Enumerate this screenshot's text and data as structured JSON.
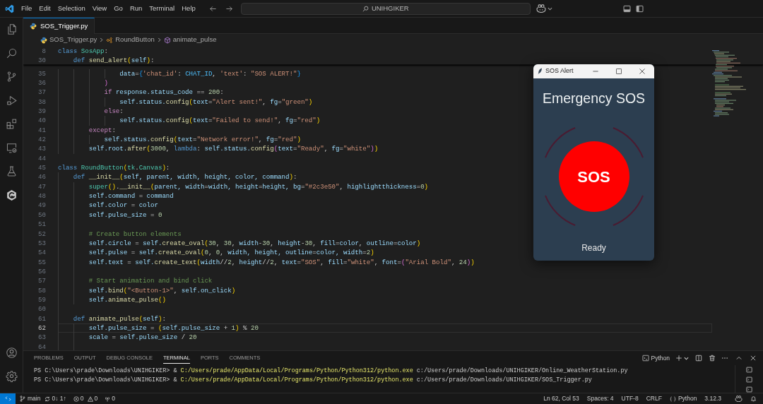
{
  "title_bar": {
    "menu": [
      "File",
      "Edit",
      "Selection",
      "View",
      "Go",
      "Run",
      "Terminal",
      "Help"
    ],
    "search": {
      "value": "UNIHGIKER"
    }
  },
  "tabs": [
    {
      "label": "SOS_Trigger.py",
      "selected": true
    }
  ],
  "breadcrumbs": [
    {
      "kind": "file",
      "label": "SOS_Trigger.py"
    },
    {
      "kind": "class",
      "label": "RoundButton"
    },
    {
      "kind": "method",
      "label": "animate_pulse"
    }
  ],
  "editor": {
    "sticky_lines": [
      {
        "number": "8",
        "tokens": [
          {
            "kind": "kw",
            "text": "class "
          },
          {
            "kind": "cls",
            "text": "SosApp"
          },
          {
            "kind": "plain",
            "text": ":"
          }
        ]
      },
      {
        "number": "30",
        "tokens": [
          {
            "kind": "kw",
            "text": "    def "
          },
          {
            "kind": "fn",
            "text": "send_alert"
          },
          {
            "kind": "br1",
            "text": "("
          },
          {
            "kind": "var",
            "text": "self"
          },
          {
            "kind": "br1",
            "text": ")"
          },
          {
            "kind": "plain",
            "text": ":"
          }
        ]
      }
    ],
    "lines": [
      {
        "number": "35",
        "current": false,
        "tokens": [
          {
            "kind": "var",
            "text": "                data"
          },
          {
            "kind": "plain",
            "text": "="
          },
          {
            "kind": "br3",
            "text": "{"
          },
          {
            "kind": "str",
            "text": "'chat_id'"
          },
          {
            "kind": "plain",
            "text": ": "
          },
          {
            "kind": "const",
            "text": "CHAT_ID"
          },
          {
            "kind": "plain",
            "text": ", "
          },
          {
            "kind": "str",
            "text": "'text'"
          },
          {
            "kind": "plain",
            "text": ": "
          },
          {
            "kind": "str",
            "text": "\"SOS ALERT!\""
          },
          {
            "kind": "br3",
            "text": "}"
          }
        ]
      },
      {
        "number": "36",
        "current": false,
        "tokens": [
          {
            "kind": "br2",
            "text": "            )"
          }
        ]
      },
      {
        "number": "37",
        "current": false,
        "tokens": [
          {
            "kind": "ctl",
            "text": "            if "
          },
          {
            "kind": "var",
            "text": "response.status_code"
          },
          {
            "kind": "plain",
            "text": " == "
          },
          {
            "kind": "num",
            "text": "200"
          },
          {
            "kind": "plain",
            "text": ":"
          }
        ]
      },
      {
        "number": "38",
        "current": false,
        "tokens": [
          {
            "kind": "var",
            "text": "                self.status."
          },
          {
            "kind": "fn",
            "text": "config"
          },
          {
            "kind": "br1",
            "text": "("
          },
          {
            "kind": "var",
            "text": "text"
          },
          {
            "kind": "plain",
            "text": "="
          },
          {
            "kind": "str",
            "text": "\"Alert sent!\""
          },
          {
            "kind": "plain",
            "text": ", "
          },
          {
            "kind": "var",
            "text": "fg"
          },
          {
            "kind": "plain",
            "text": "="
          },
          {
            "kind": "str",
            "text": "\"green\""
          },
          {
            "kind": "br1",
            "text": ")"
          }
        ]
      },
      {
        "number": "39",
        "current": false,
        "tokens": [
          {
            "kind": "ctl",
            "text": "            else"
          },
          {
            "kind": "plain",
            "text": ":"
          }
        ]
      },
      {
        "number": "40",
        "current": false,
        "tokens": [
          {
            "kind": "var",
            "text": "                self.status."
          },
          {
            "kind": "fn",
            "text": "config"
          },
          {
            "kind": "br1",
            "text": "("
          },
          {
            "kind": "var",
            "text": "text"
          },
          {
            "kind": "plain",
            "text": "="
          },
          {
            "kind": "str",
            "text": "\"Failed to send!\""
          },
          {
            "kind": "plain",
            "text": ", "
          },
          {
            "kind": "var",
            "text": "fg"
          },
          {
            "kind": "plain",
            "text": "="
          },
          {
            "kind": "str",
            "text": "\"red\""
          },
          {
            "kind": "br1",
            "text": ")"
          }
        ]
      },
      {
        "number": "41",
        "current": false,
        "tokens": [
          {
            "kind": "ctl",
            "text": "        except"
          },
          {
            "kind": "plain",
            "text": ":"
          }
        ]
      },
      {
        "number": "42",
        "current": false,
        "tokens": [
          {
            "kind": "var",
            "text": "            self.status."
          },
          {
            "kind": "fn",
            "text": "config"
          },
          {
            "kind": "br1",
            "text": "("
          },
          {
            "kind": "var",
            "text": "text"
          },
          {
            "kind": "plain",
            "text": "="
          },
          {
            "kind": "str",
            "text": "\"Network error!\""
          },
          {
            "kind": "plain",
            "text": ", "
          },
          {
            "kind": "var",
            "text": "fg"
          },
          {
            "kind": "plain",
            "text": "="
          },
          {
            "kind": "str",
            "text": "\"red\""
          },
          {
            "kind": "br1",
            "text": ")"
          }
        ]
      },
      {
        "number": "43",
        "current": false,
        "tokens": [
          {
            "kind": "var",
            "text": "        self.root."
          },
          {
            "kind": "fn",
            "text": "after"
          },
          {
            "kind": "br1",
            "text": "("
          },
          {
            "kind": "num",
            "text": "3000"
          },
          {
            "kind": "plain",
            "text": ", "
          },
          {
            "kind": "kw",
            "text": "lambda"
          },
          {
            "kind": "plain",
            "text": ": "
          },
          {
            "kind": "var",
            "text": "self.status."
          },
          {
            "kind": "fn",
            "text": "config"
          },
          {
            "kind": "br2",
            "text": "("
          },
          {
            "kind": "var",
            "text": "text"
          },
          {
            "kind": "plain",
            "text": "="
          },
          {
            "kind": "str",
            "text": "\"Ready\""
          },
          {
            "kind": "plain",
            "text": ", "
          },
          {
            "kind": "var",
            "text": "fg"
          },
          {
            "kind": "plain",
            "text": "="
          },
          {
            "kind": "str",
            "text": "\"white\""
          },
          {
            "kind": "br2",
            "text": ")"
          },
          {
            "kind": "br1",
            "text": ")"
          }
        ]
      },
      {
        "number": "44",
        "current": false
      },
      {
        "number": "45",
        "current": false,
        "tokens": [
          {
            "kind": "kw",
            "text": "class "
          },
          {
            "kind": "cls",
            "text": "RoundButton"
          },
          {
            "kind": "br1",
            "text": "("
          },
          {
            "kind": "cls",
            "text": "tk"
          },
          {
            "kind": "plain",
            "text": "."
          },
          {
            "kind": "cls",
            "text": "Canvas"
          },
          {
            "kind": "br1",
            "text": ")"
          },
          {
            "kind": "plain",
            "text": ":"
          }
        ]
      },
      {
        "number": "46",
        "current": false,
        "tokens": [
          {
            "kind": "kw",
            "text": "    def "
          },
          {
            "kind": "fn",
            "text": "__init__"
          },
          {
            "kind": "br1",
            "text": "("
          },
          {
            "kind": "var",
            "text": "self, parent, width, height, color, command"
          },
          {
            "kind": "br1",
            "text": ")"
          },
          {
            "kind": "plain",
            "text": ":"
          }
        ]
      },
      {
        "number": "47",
        "current": false,
        "tokens": [
          {
            "kind": "cls",
            "text": "        super"
          },
          {
            "kind": "br1",
            "text": "()"
          },
          {
            "kind": "plain",
            "text": "."
          },
          {
            "kind": "fn",
            "text": "__init__"
          },
          {
            "kind": "br1",
            "text": "("
          },
          {
            "kind": "var",
            "text": "parent, width"
          },
          {
            "kind": "plain",
            "text": "="
          },
          {
            "kind": "var",
            "text": "width, height"
          },
          {
            "kind": "plain",
            "text": "="
          },
          {
            "kind": "var",
            "text": "height, bg"
          },
          {
            "kind": "plain",
            "text": "="
          },
          {
            "kind": "str",
            "text": "\"#2c3e50\""
          },
          {
            "kind": "plain",
            "text": ", "
          },
          {
            "kind": "var",
            "text": "highlightthickness"
          },
          {
            "kind": "plain",
            "text": "="
          },
          {
            "kind": "num",
            "text": "0"
          },
          {
            "kind": "br1",
            "text": ")"
          }
        ]
      },
      {
        "number": "48",
        "current": false,
        "tokens": [
          {
            "kind": "var",
            "text": "        self.command"
          },
          {
            "kind": "plain",
            "text": " = "
          },
          {
            "kind": "var",
            "text": "command"
          }
        ]
      },
      {
        "number": "49",
        "current": false,
        "tokens": [
          {
            "kind": "var",
            "text": "        self.color"
          },
          {
            "kind": "plain",
            "text": " = "
          },
          {
            "kind": "var",
            "text": "color"
          }
        ]
      },
      {
        "number": "50",
        "current": false,
        "tokens": [
          {
            "kind": "var",
            "text": "        self.pulse_size"
          },
          {
            "kind": "plain",
            "text": " = "
          },
          {
            "kind": "num",
            "text": "0"
          }
        ]
      },
      {
        "number": "51",
        "current": false
      },
      {
        "number": "52",
        "current": false,
        "tokens": [
          {
            "kind": "cmt",
            "text": "        # Create button elements"
          }
        ]
      },
      {
        "number": "53",
        "current": false,
        "tokens": [
          {
            "kind": "var",
            "text": "        self.circle"
          },
          {
            "kind": "plain",
            "text": " = "
          },
          {
            "kind": "var",
            "text": "self."
          },
          {
            "kind": "fn",
            "text": "create_oval"
          },
          {
            "kind": "br1",
            "text": "("
          },
          {
            "kind": "num",
            "text": "30"
          },
          {
            "kind": "plain",
            "text": ", "
          },
          {
            "kind": "num",
            "text": "30"
          },
          {
            "kind": "plain",
            "text": ", "
          },
          {
            "kind": "var",
            "text": "width"
          },
          {
            "kind": "plain",
            "text": "-"
          },
          {
            "kind": "num",
            "text": "30"
          },
          {
            "kind": "plain",
            "text": ", "
          },
          {
            "kind": "var",
            "text": "height"
          },
          {
            "kind": "plain",
            "text": "-"
          },
          {
            "kind": "num",
            "text": "30"
          },
          {
            "kind": "plain",
            "text": ", "
          },
          {
            "kind": "var",
            "text": "fill"
          },
          {
            "kind": "plain",
            "text": "="
          },
          {
            "kind": "var",
            "text": "color"
          },
          {
            "kind": "plain",
            "text": ", "
          },
          {
            "kind": "var",
            "text": "outline"
          },
          {
            "kind": "plain",
            "text": "="
          },
          {
            "kind": "var",
            "text": "color"
          },
          {
            "kind": "br1",
            "text": ")"
          }
        ]
      },
      {
        "number": "54",
        "current": false,
        "tokens": [
          {
            "kind": "var",
            "text": "        self.pulse"
          },
          {
            "kind": "plain",
            "text": " = "
          },
          {
            "kind": "var",
            "text": "self."
          },
          {
            "kind": "fn",
            "text": "create_oval"
          },
          {
            "kind": "br1",
            "text": "("
          },
          {
            "kind": "num",
            "text": "0"
          },
          {
            "kind": "plain",
            "text": ", "
          },
          {
            "kind": "num",
            "text": "0"
          },
          {
            "kind": "plain",
            "text": ", "
          },
          {
            "kind": "var",
            "text": "width, height, outline"
          },
          {
            "kind": "plain",
            "text": "="
          },
          {
            "kind": "var",
            "text": "color, width"
          },
          {
            "kind": "plain",
            "text": "="
          },
          {
            "kind": "num",
            "text": "2"
          },
          {
            "kind": "br1",
            "text": ")"
          }
        ]
      },
      {
        "number": "55",
        "current": false,
        "tokens": [
          {
            "kind": "var",
            "text": "        self.text"
          },
          {
            "kind": "plain",
            "text": " = "
          },
          {
            "kind": "var",
            "text": "self."
          },
          {
            "kind": "fn",
            "text": "create_text"
          },
          {
            "kind": "br1",
            "text": "("
          },
          {
            "kind": "var",
            "text": "width"
          },
          {
            "kind": "plain",
            "text": "//"
          },
          {
            "kind": "num",
            "text": "2"
          },
          {
            "kind": "plain",
            "text": ", "
          },
          {
            "kind": "var",
            "text": "height"
          },
          {
            "kind": "plain",
            "text": "//"
          },
          {
            "kind": "num",
            "text": "2"
          },
          {
            "kind": "plain",
            "text": ", "
          },
          {
            "kind": "var",
            "text": "text"
          },
          {
            "kind": "plain",
            "text": "="
          },
          {
            "kind": "str",
            "text": "\"SOS\""
          },
          {
            "kind": "plain",
            "text": ", "
          },
          {
            "kind": "var",
            "text": "fill"
          },
          {
            "kind": "plain",
            "text": "="
          },
          {
            "kind": "str",
            "text": "\"white\""
          },
          {
            "kind": "plain",
            "text": ", "
          },
          {
            "kind": "var",
            "text": "font"
          },
          {
            "kind": "plain",
            "text": "="
          },
          {
            "kind": "br2",
            "text": "("
          },
          {
            "kind": "str",
            "text": "\"Arial Bold\""
          },
          {
            "kind": "plain",
            "text": ", "
          },
          {
            "kind": "num",
            "text": "24"
          },
          {
            "kind": "br2",
            "text": ")"
          },
          {
            "kind": "br1",
            "text": ")"
          }
        ]
      },
      {
        "number": "56",
        "current": false
      },
      {
        "number": "57",
        "current": false,
        "tokens": [
          {
            "kind": "cmt",
            "text": "        # Start animation and bind click"
          }
        ]
      },
      {
        "number": "58",
        "current": false,
        "tokens": [
          {
            "kind": "var",
            "text": "        self."
          },
          {
            "kind": "fn",
            "text": "bind"
          },
          {
            "kind": "br1",
            "text": "("
          },
          {
            "kind": "str",
            "text": "\"<Button-1>\""
          },
          {
            "kind": "plain",
            "text": ", "
          },
          {
            "kind": "var",
            "text": "self.on_click"
          },
          {
            "kind": "br1",
            "text": ")"
          }
        ]
      },
      {
        "number": "59",
        "current": false,
        "tokens": [
          {
            "kind": "var",
            "text": "        self."
          },
          {
            "kind": "fn",
            "text": "animate_pulse"
          },
          {
            "kind": "br1",
            "text": "()"
          }
        ]
      },
      {
        "number": "60",
        "current": false
      },
      {
        "number": "61",
        "current": false,
        "tokens": [
          {
            "kind": "kw",
            "text": "    def "
          },
          {
            "kind": "fn",
            "text": "animate_pulse"
          },
          {
            "kind": "br1",
            "text": "("
          },
          {
            "kind": "var",
            "text": "self"
          },
          {
            "kind": "br1",
            "text": ")"
          },
          {
            "kind": "plain",
            "text": ":"
          }
        ]
      },
      {
        "number": "62",
        "current": true,
        "tokens": [
          {
            "kind": "var",
            "text": "        self.pulse_size"
          },
          {
            "kind": "plain",
            "text": " = "
          },
          {
            "kind": "br1",
            "text": "("
          },
          {
            "kind": "var",
            "text": "self.pulse_size"
          },
          {
            "kind": "plain",
            "text": " + "
          },
          {
            "kind": "num",
            "text": "1"
          },
          {
            "kind": "br1",
            "text": ")"
          },
          {
            "kind": "plain",
            "text": " % "
          },
          {
            "kind": "num",
            "text": "20"
          }
        ]
      },
      {
        "number": "63",
        "current": false,
        "tokens": [
          {
            "kind": "var",
            "text": "        scale"
          },
          {
            "kind": "plain",
            "text": " = "
          },
          {
            "kind": "var",
            "text": "self.pulse_size"
          },
          {
            "kind": "plain",
            "text": " / "
          },
          {
            "kind": "num",
            "text": "20"
          }
        ]
      },
      {
        "number": "64",
        "current": false
      }
    ]
  },
  "sos_window": {
    "title": "SOS Alert",
    "heading": "Emergency SOS",
    "button_label": "SOS",
    "status": "Ready"
  },
  "panel": {
    "tabs": [
      {
        "label": "PROBLEMS",
        "selected": false
      },
      {
        "label": "OUTPUT",
        "selected": false
      },
      {
        "label": "DEBUG CONSOLE",
        "selected": false
      },
      {
        "label": "TERMINAL",
        "selected": true
      },
      {
        "label": "PORTS",
        "selected": false
      },
      {
        "label": "COMMENTS",
        "selected": false
      }
    ],
    "terminal_profile": "Python",
    "terminal_lines": [
      {
        "tokens": [
          {
            "kind": "prompt",
            "text": "PS C:\\Users\\prade\\Downloads\\UNIHGIKER> & "
          },
          {
            "kind": "command",
            "text": "C:/Users/prade/AppData/Local/Programs/Python/Python312/python.exe"
          },
          {
            "kind": "argument",
            "text": " c:/Users/prade/Downloads/UNIHGIKER/Online_WeatherStation.py"
          }
        ]
      },
      {
        "tokens": [
          {
            "kind": "prompt",
            "text": "PS C:\\Users\\prade\\Downloads\\UNIHGIKER> & "
          },
          {
            "kind": "command",
            "text": "C:/Users/prade/AppData/Local/Programs/Python/Python312/python.exe"
          },
          {
            "kind": "argument",
            "text": " c:/Users/prade/Downloads/UNIHGIKER/SOS_Trigger.py"
          }
        ]
      }
    ]
  },
  "status_bar": {
    "branch": "main",
    "sync": "0↓ 1↑",
    "errors": "0",
    "warnings": "0",
    "ports": "0",
    "cursor_position": "Ln 62, Col 53",
    "indentation": "Spaces: 4",
    "encoding": "UTF-8",
    "line_ending": "CRLF",
    "language": "Python",
    "python_version": "3.12.3"
  }
}
